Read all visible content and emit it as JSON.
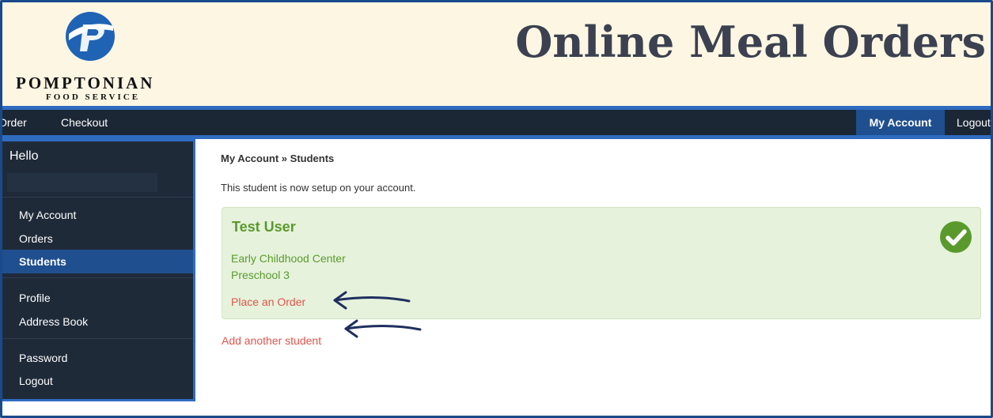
{
  "brand": {
    "name": "POMPTONIAN",
    "subtitle": "FOOD SERVICE",
    "site_title": "Online Meal Orders",
    "logo_icon": "pomptonian-p-logo"
  },
  "nav": {
    "order": "Order",
    "checkout": "Checkout",
    "my_account": "My Account",
    "logout": "Logout"
  },
  "sidebar": {
    "greeting": "Hello",
    "groups": [
      [
        "My Account",
        "Orders",
        "Students"
      ],
      [
        "Profile",
        "Address Book"
      ],
      [
        "Password",
        "Logout"
      ]
    ],
    "items": [
      {
        "label": "My Account"
      },
      {
        "label": "Orders"
      },
      {
        "label": "Students",
        "active": true
      },
      {
        "label": "Profile"
      },
      {
        "label": "Address Book"
      },
      {
        "label": "Password"
      },
      {
        "label": "Logout"
      }
    ]
  },
  "main": {
    "breadcrumb": "My Account » Students",
    "notice": "This student is now setup on your account.",
    "student": {
      "name": "Test User",
      "school": "Early Childhood Center",
      "grade": "Preschool 3",
      "action": "Place an Order",
      "status_icon": "check-circle-icon"
    },
    "add_student": "Add another student"
  },
  "colors": {
    "nav_bg": "#1c2735",
    "accent_blue": "#2f6cc0",
    "active_bg": "#1f4f8f",
    "success_bg": "#e6f2dc",
    "success_text": "#5a9a2c",
    "link_red": "#e0554b",
    "header_bg": "#fdf6e3",
    "annotation_arrow": "#1f2f5f"
  }
}
